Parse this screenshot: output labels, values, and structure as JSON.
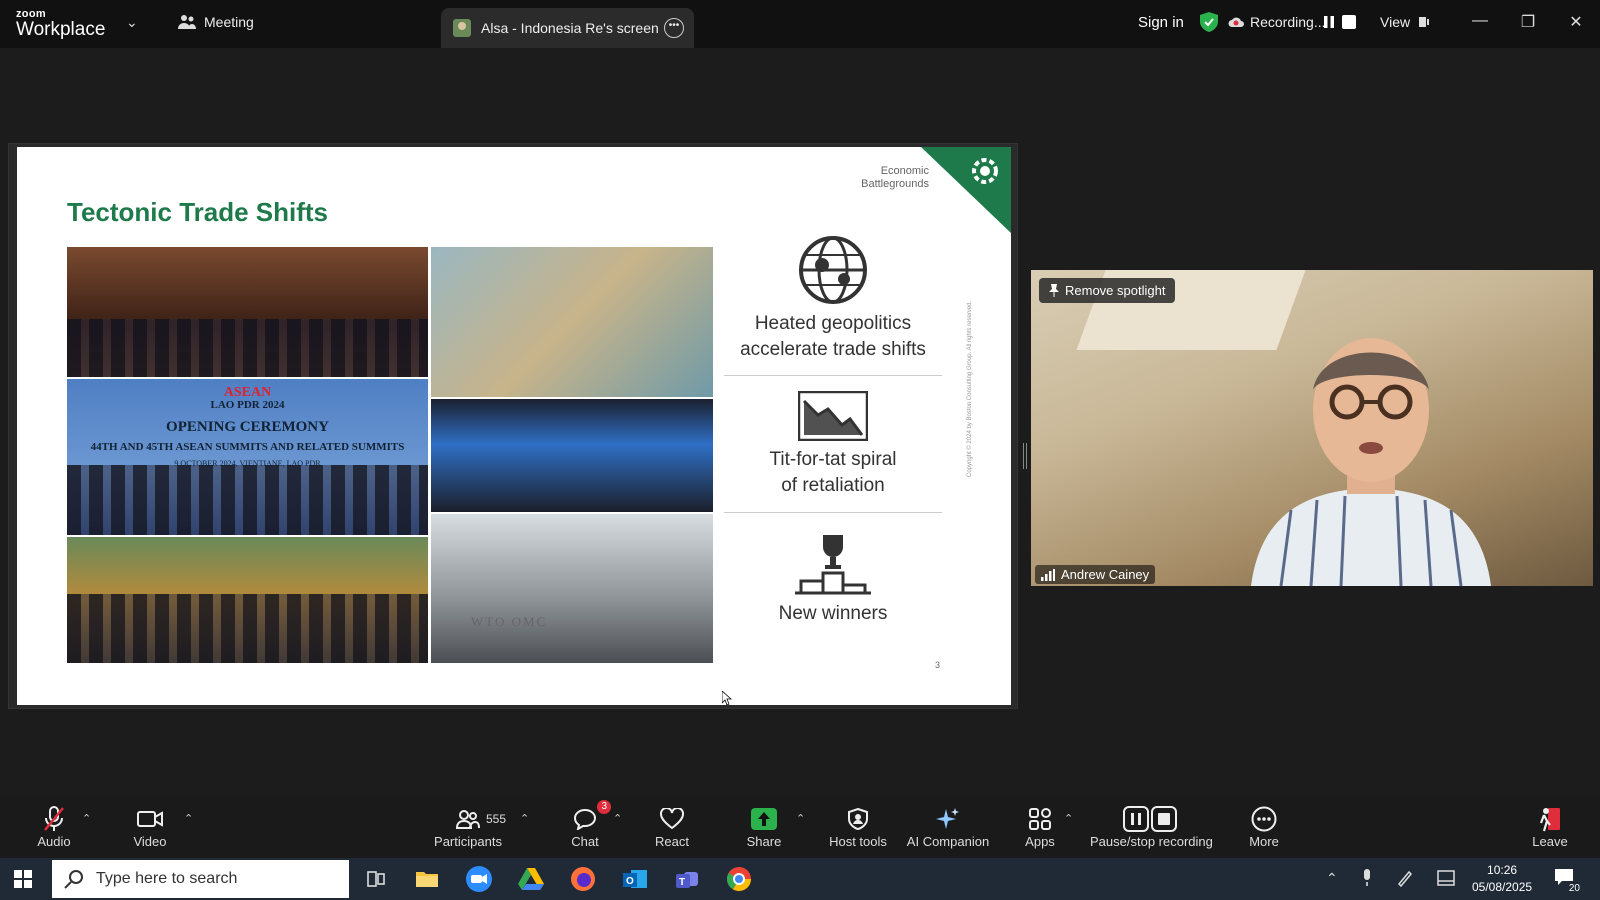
{
  "titlebar": {
    "logo_small": "zoom",
    "logo_big": "Workplace",
    "meeting_tab": "Meeting",
    "share_tab": "Alsa - Indonesia Re's screen",
    "sign_in": "Sign in",
    "recording": "Recording...",
    "view": "View",
    "shield_color": "#2bb24c"
  },
  "slide": {
    "title": "Tectonic Trade Shifts",
    "brand_line1": "Economic",
    "brand_line2": "Battlegrounds",
    "accent_color": "#1e7a4a",
    "asean": {
      "logo": "ASEAN",
      "sub": "LAO PDR 2024",
      "ceremony": "OPENING CEREMONY",
      "summits": "44TH AND 45TH ASEAN SUMMITS AND RELATED SUMMITS",
      "date": "9 OCTOBER 2024, VIENTIANE, LAO PDR"
    },
    "wto": "WTO OMC",
    "items": [
      {
        "icon": "globe-icon",
        "line1": "Heated geopolitics",
        "line2": "accelerate trade shifts"
      },
      {
        "icon": "declining-chart-icon",
        "line1": "Tit-for-tat spiral",
        "line2": "of retaliation"
      },
      {
        "icon": "trophy-podium-icon",
        "line1": "New winners",
        "line2": ""
      }
    ],
    "page_number": "3",
    "copyright": "Copyright © 2024 by Boston Consulting Group. All rights reserved."
  },
  "video": {
    "remove_spotlight": "Remove spotlight",
    "participant_name": "Andrew Cainey"
  },
  "toolbar": {
    "audio": "Audio",
    "video": "Video",
    "participants": "Participants",
    "participants_count": "555",
    "chat": "Chat",
    "chat_badge": "3",
    "react": "React",
    "share": "Share",
    "host_tools": "Host tools",
    "ai_companion": "AI Companion",
    "apps": "Apps",
    "pause_stop": "Pause/stop recording",
    "more": "More",
    "leave": "Leave"
  },
  "taskbar": {
    "search_placeholder": "Type here to search",
    "time": "10:26",
    "date": "05/08/2025",
    "notification_count": "20"
  }
}
